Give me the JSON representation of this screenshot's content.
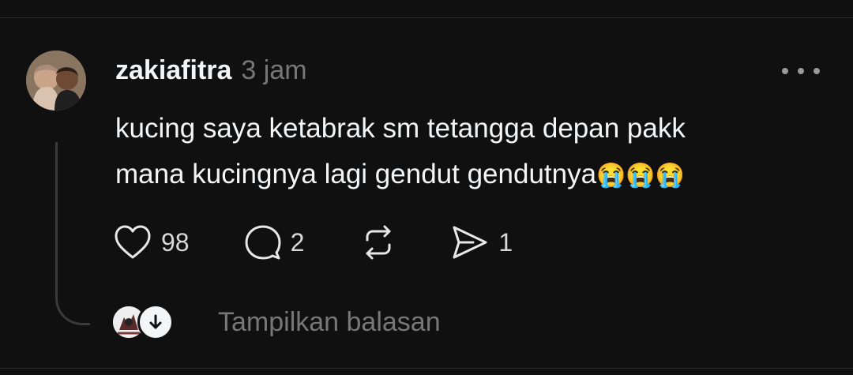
{
  "post": {
    "username": "zakiafitra",
    "timestamp": "3 jam",
    "text_line1": "kucing saya ketabrak sm tetangga depan pakk",
    "text_line2": "mana kucingnya lagi gendut gendutnya",
    "emojis": "😭😭😭"
  },
  "actions": {
    "likes": "98",
    "comments": "2",
    "shares": "1"
  },
  "replies": {
    "show_label": "Tampilkan balasan"
  },
  "icons": {
    "more": "more-horizontal-icon",
    "like": "heart-icon",
    "comment": "comment-icon",
    "repost": "repost-icon",
    "share": "send-icon",
    "expand": "arrow-down-icon"
  },
  "colors": {
    "background": "#101010",
    "text": "#f3f5f7",
    "muted": "#777777"
  }
}
